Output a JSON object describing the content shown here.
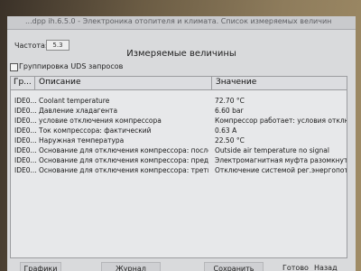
{
  "window": {
    "title": "...dpp ih.6.5.0 - Электроника отопителя и климата. Список измеряемых величин"
  },
  "frequency": {
    "label": "Частота:",
    "value": "5.3"
  },
  "header": "Измеряемые величины",
  "uds_group": {
    "label": "Группировка UDS запросов",
    "checked": false
  },
  "table": {
    "columns": [
      "Гр...",
      "Описание",
      "Значение"
    ],
    "rows": [
      {
        "id": "IDE0...",
        "desc": "Coolant temperature",
        "val": "72.70 °C"
      },
      {
        "id": "IDE0...",
        "desc": "Давление хладагента",
        "val": "6.60 bar"
      },
      {
        "id": "IDE0...",
        "desc": "условие отключения компрессора",
        "val": "Компрессор работает: условия отключени"
      },
      {
        "id": "IDE0...",
        "desc": "Ток компрессора: фактический",
        "val": "0.63 A"
      },
      {
        "id": "IDE0...",
        "desc": "Наружная температура",
        "val": "22.50 °C"
      },
      {
        "id": "IDE0...",
        "desc": "Основание для отключения компрессора: после...",
        "val": "Outside air temperature no signal"
      },
      {
        "id": "IDE0...",
        "desc": "Основание для отключения компрессора: преды...",
        "val": "Электромагнитная муфта разомкнута"
      },
      {
        "id": "IDE0...",
        "desc": "Основание для отключения компрессора: третье...",
        "val": "Отключение системой рег.энергопотреблен"
      }
    ]
  },
  "footer": {
    "charts": "Графики",
    "log": "Журнал",
    "save": "Сохранить",
    "done": "Готово",
    "back": "Назад"
  }
}
